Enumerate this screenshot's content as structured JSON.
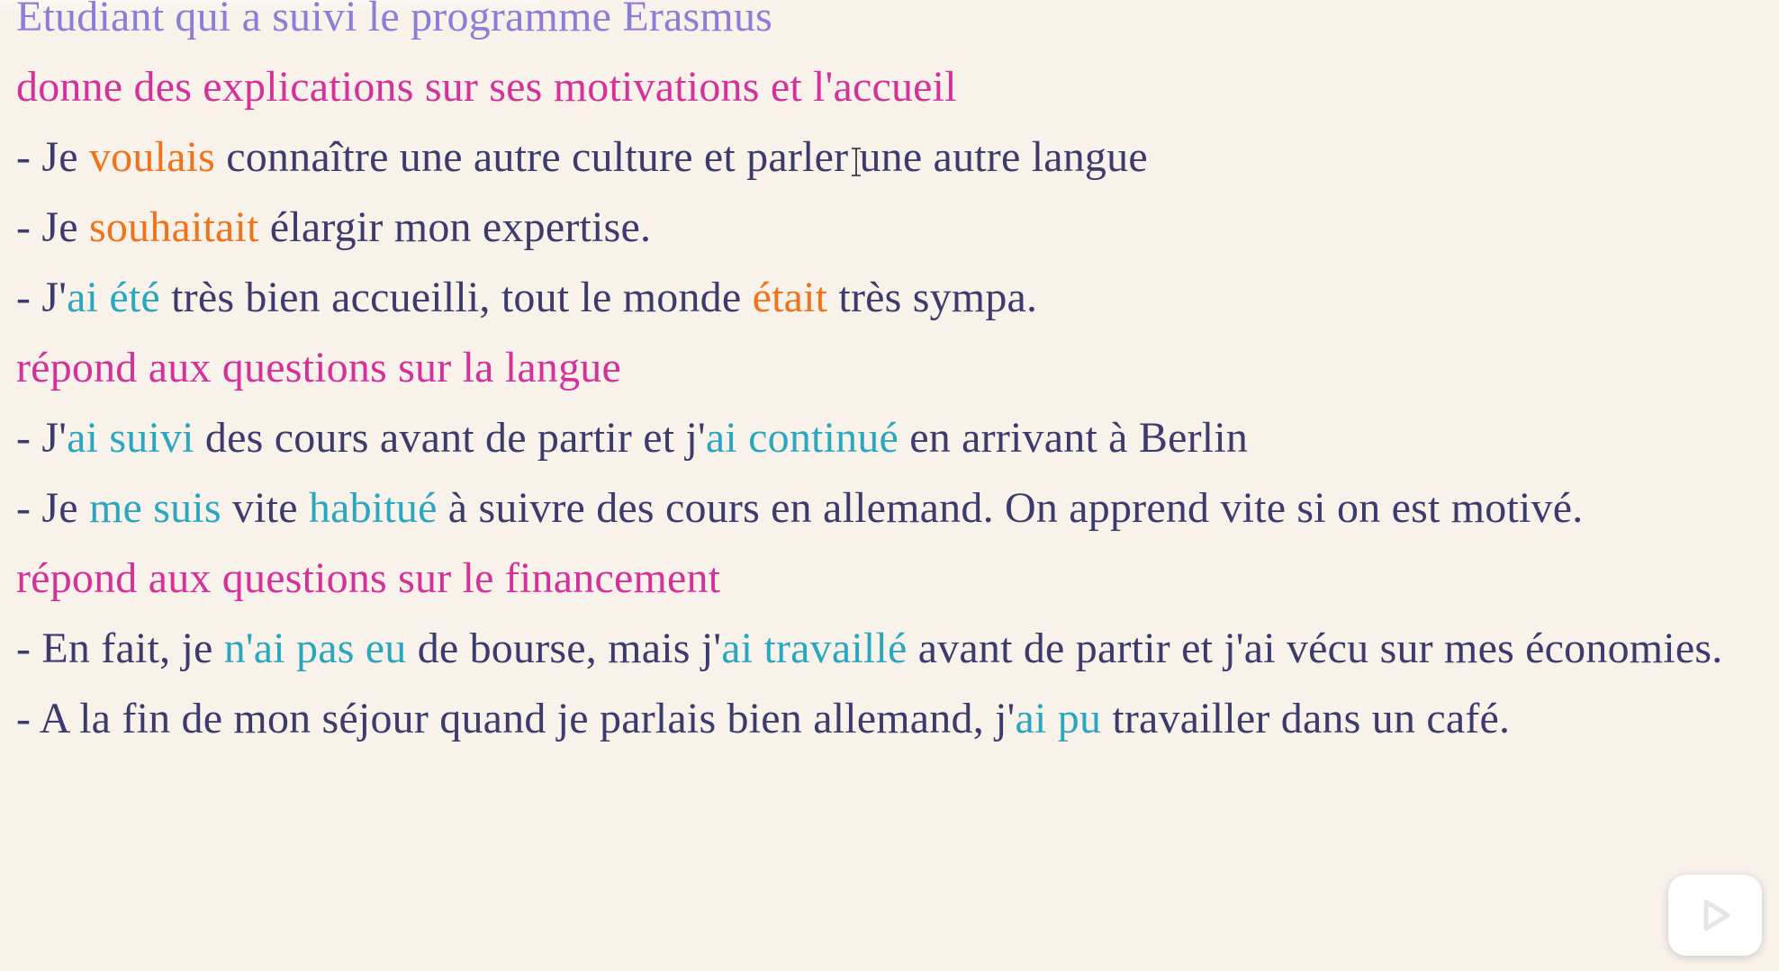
{
  "document": {
    "title": "Etudiant qui a suivi le programme Erasmus",
    "lines": [
      {
        "type": "heading",
        "segments": [
          {
            "text": "donne des explications sur ses motivations et l'accueil",
            "color": "heading"
          }
        ]
      },
      {
        "type": "sentence",
        "segments": [
          {
            "text": "- Je ",
            "color": "plain"
          },
          {
            "text": "voulais",
            "color": "orange"
          },
          {
            "text": " connaître une autre culture et parler une autre langue",
            "color": "plain"
          }
        ]
      },
      {
        "type": "sentence",
        "segments": [
          {
            "text": "- Je ",
            "color": "plain"
          },
          {
            "text": "souhaitait",
            "color": "orange"
          },
          {
            "text": " élargir mon expertise.",
            "color": "plain"
          }
        ]
      },
      {
        "type": "sentence",
        "segments": [
          {
            "text": "- J'",
            "color": "plain"
          },
          {
            "text": "ai été",
            "color": "teal"
          },
          {
            "text": " très bien accueilli, tout le monde ",
            "color": "plain"
          },
          {
            "text": "était",
            "color": "orange"
          },
          {
            "text": " très sympa.",
            "color": "plain"
          }
        ]
      },
      {
        "type": "heading",
        "segments": [
          {
            "text": "répond aux questions sur la langue",
            "color": "heading"
          }
        ]
      },
      {
        "type": "sentence",
        "segments": [
          {
            "text": "- J'",
            "color": "plain"
          },
          {
            "text": "ai suivi",
            "color": "teal"
          },
          {
            "text": " des cours avant de partir et j'",
            "color": "plain"
          },
          {
            "text": "ai continué",
            "color": "teal"
          },
          {
            "text": " en arrivant à Berlin",
            "color": "plain"
          }
        ]
      },
      {
        "type": "sentence",
        "wrap": true,
        "segments": [
          {
            "text": "- Je ",
            "color": "plain"
          },
          {
            "text": "me suis",
            "color": "teal"
          },
          {
            "text": " vite ",
            "color": "plain"
          },
          {
            "text": "habitué",
            "color": "teal"
          },
          {
            "text": " à suivre des cours en allemand. On apprend vite si on est motivé.",
            "color": "plain"
          }
        ]
      },
      {
        "type": "heading",
        "segments": [
          {
            "text": "répond aux questions sur le financement",
            "color": "heading"
          }
        ]
      },
      {
        "type": "sentence",
        "wrap": true,
        "segments": [
          {
            "text": "- En fait, je ",
            "color": "plain"
          },
          {
            "text": "n'ai pas eu",
            "color": "teal"
          },
          {
            "text": " de bourse, mais j'",
            "color": "plain"
          },
          {
            "text": "ai travaillé",
            "color": "teal"
          },
          {
            "text": " avant de partir et j'ai vécu sur mes économies.",
            "color": "plain"
          }
        ]
      },
      {
        "type": "sentence",
        "wrap": true,
        "segments": [
          {
            "text": "- A la fin de mon séjour quand je parlais bien allemand, j'",
            "color": "plain"
          },
          {
            "text": "ai pu",
            "color": "teal"
          },
          {
            "text": " travailler dans un café.",
            "color": "plain"
          }
        ]
      }
    ]
  },
  "colors": {
    "background": "#f8f2ea",
    "title": "#8b7ed6",
    "heading": "#d6309a",
    "plain": "#3d3a6e",
    "orange": "#f0731c",
    "teal": "#2aa7c0"
  },
  "icons": {
    "cursor": "text-cursor-icon",
    "play": "play-icon"
  }
}
